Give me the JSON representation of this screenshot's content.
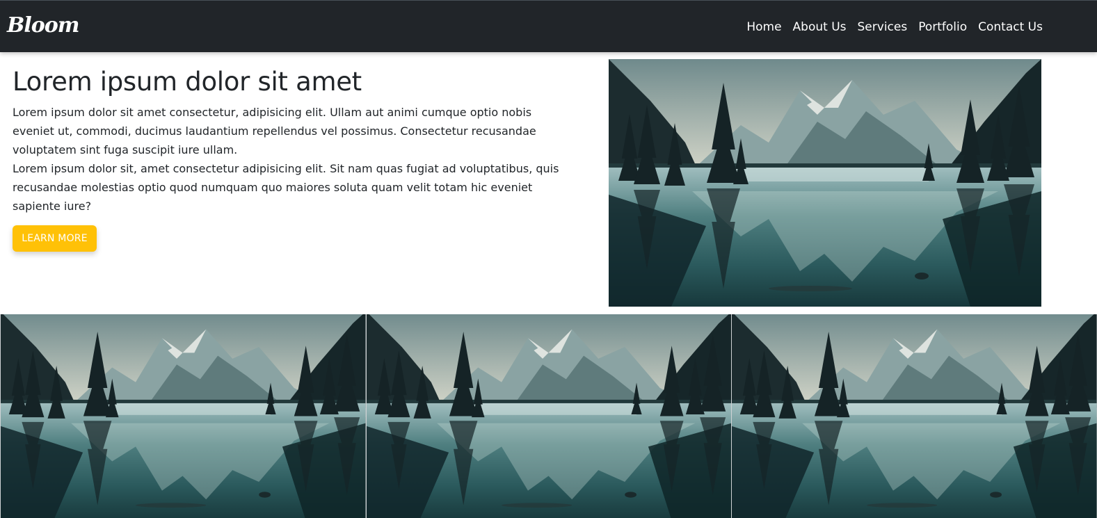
{
  "navbar": {
    "brand": "Bloom",
    "links": [
      "Home",
      "About Us",
      "Services",
      "Portfolio",
      "Contact Us"
    ]
  },
  "hero": {
    "title": "Lorem ipsum dolor sit amet",
    "paragraph_1": "Lorem ipsum dolor sit amet consectetur, adipisicing elit. Ullam aut animi cumque optio nobis eveniet ut, commodi, ducimus laudantium repellendus vel possimus. Consectetur recusandae voluptatem sint fuga suscipit iure ullam.",
    "paragraph_2": "Lorem ipsum dolor sit, amet consectetur adipisicing elit. Sit nam quas fugiat ad voluptatibus, quis recusandae molestias optio quod numquam quo maiores soluta quam velit totam hic eveniet sapiente iure?",
    "button_label": "LEARN MORE"
  },
  "colors": {
    "navbar_bg": "#212529",
    "accent": "#ffc107",
    "text": "#212529"
  }
}
